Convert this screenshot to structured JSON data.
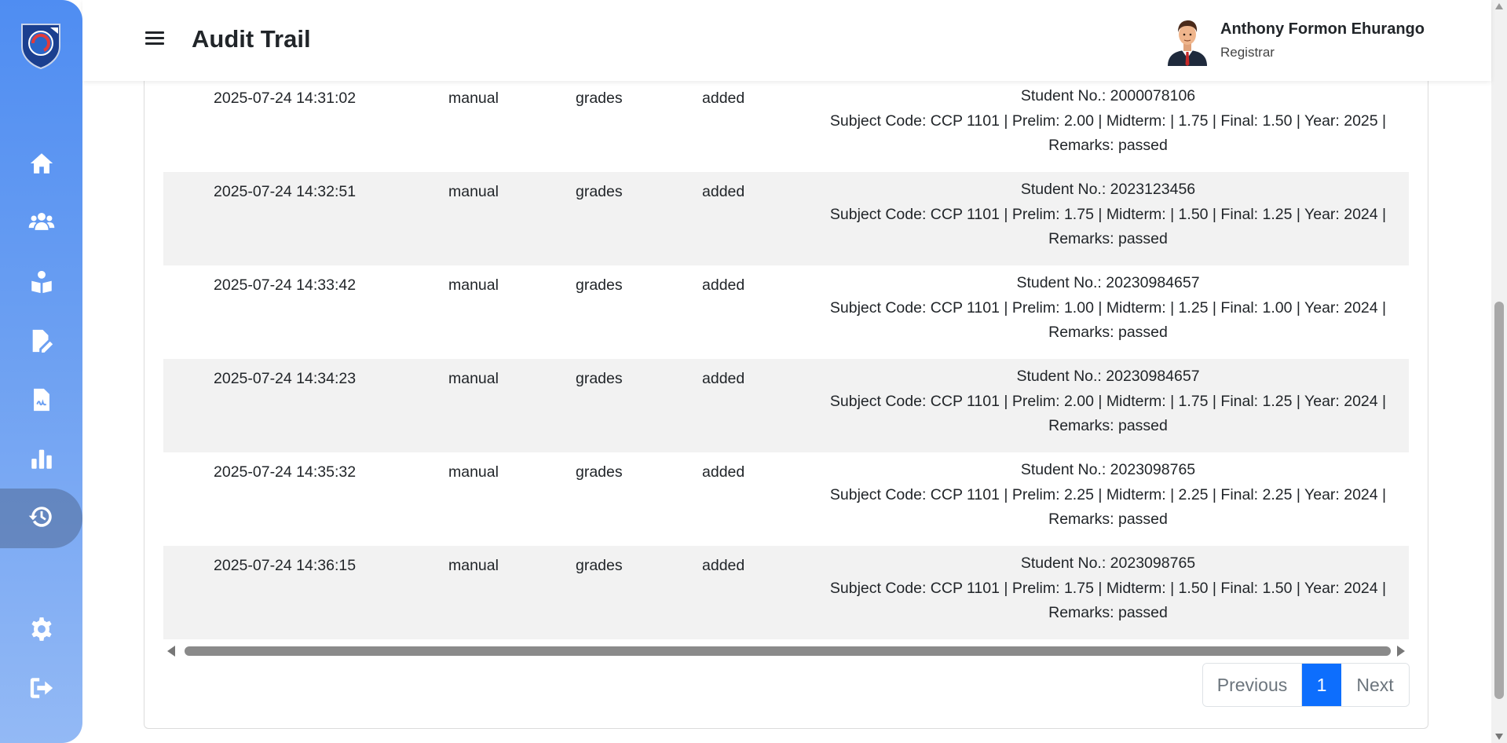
{
  "header": {
    "title": "Audit Trail",
    "user_name": "Anthony Formon Ehurango",
    "user_role": "Registrar"
  },
  "sidebar": {
    "items": [
      {
        "icon": "home-icon",
        "active": false
      },
      {
        "icon": "users-icon",
        "active": false
      },
      {
        "icon": "student-reading-icon",
        "active": false
      },
      {
        "icon": "file-edit-icon",
        "active": false
      },
      {
        "icon": "file-signature-icon",
        "active": false
      },
      {
        "icon": "bar-chart-icon",
        "active": false
      },
      {
        "icon": "history-icon",
        "active": true
      },
      {
        "icon": "gear-icon",
        "active": false
      },
      {
        "icon": "logout-icon",
        "active": false
      }
    ]
  },
  "rows": [
    {
      "timestamp": "2025-07-24 14:31:02",
      "method": "manual",
      "table": "grades",
      "action": "added",
      "details": "Student No.: 2000078106\nSubject Code: CCP 1101 | Prelim: 2.00 | Midterm: | 1.75 | Final: 1.50 | Year: 2025 |\nRemarks: passed"
    },
    {
      "timestamp": "2025-07-24 14:32:51",
      "method": "manual",
      "table": "grades",
      "action": "added",
      "details": "Student No.: 2023123456\nSubject Code: CCP 1101 | Prelim: 1.75 | Midterm: | 1.50 | Final: 1.25 | Year: 2024 |\nRemarks: passed"
    },
    {
      "timestamp": "2025-07-24 14:33:42",
      "method": "manual",
      "table": "grades",
      "action": "added",
      "details": "Student No.: 20230984657\nSubject Code: CCP 1101 | Prelim: 1.00 | Midterm: | 1.25 | Final: 1.00 | Year: 2024 |\nRemarks: passed"
    },
    {
      "timestamp": "2025-07-24 14:34:23",
      "method": "manual",
      "table": "grades",
      "action": "added",
      "details": "Student No.: 20230984657\nSubject Code: CCP 1101 | Prelim: 2.00 | Midterm: | 1.75 | Final: 1.25 | Year: 2024 |\nRemarks: passed"
    },
    {
      "timestamp": "2025-07-24 14:35:32",
      "method": "manual",
      "table": "grades",
      "action": "added",
      "details": "Student No.: 2023098765\nSubject Code: CCP 1101 | Prelim: 2.25 | Midterm: | 2.25 | Final: 2.25 | Year: 2024 |\nRemarks: passed"
    },
    {
      "timestamp": "2025-07-24 14:36:15",
      "method": "manual",
      "table": "grades",
      "action": "added",
      "details": "Student No.: 2023098765\nSubject Code: CCP 1101 | Prelim: 1.75 | Midterm: | 1.50 | Final: 1.50 | Year: 2024 |\nRemarks: passed"
    }
  ],
  "pagination": {
    "previous": "Previous",
    "current": "1",
    "next": "Next"
  },
  "colors": {
    "sidebar_top": "#4f8df2",
    "sidebar_bottom": "#93b9f5",
    "active_page": "#0d6efd",
    "row_stripe": "#f2f2f2"
  }
}
